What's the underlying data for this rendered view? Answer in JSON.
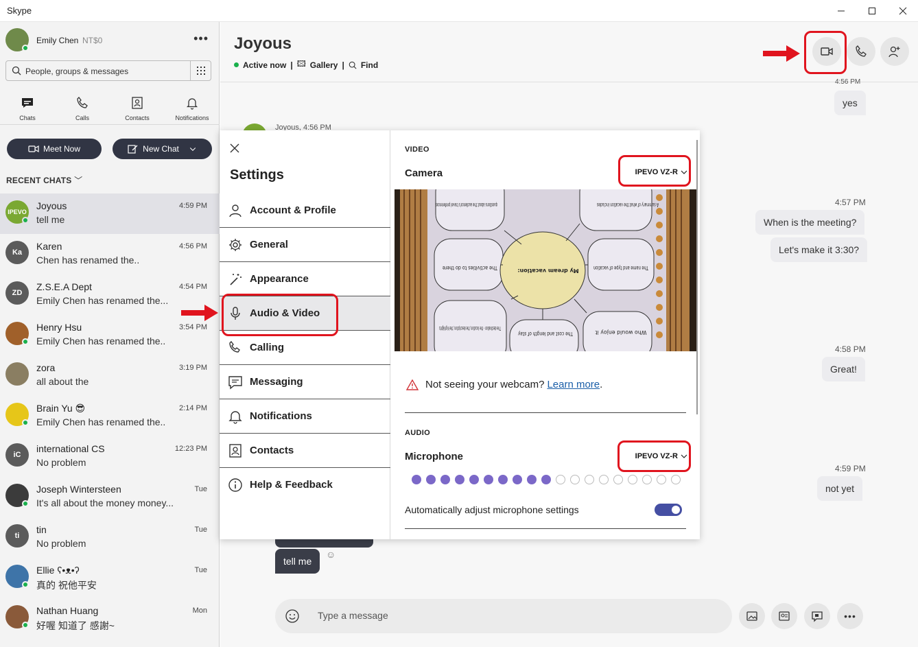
{
  "window": {
    "title": "Skype"
  },
  "profile": {
    "name": "Emily Chen",
    "credit": "NT$0"
  },
  "search": {
    "placeholder": "People, groups & messages"
  },
  "nav": {
    "chats": "Chats",
    "calls": "Calls",
    "contacts": "Contacts",
    "notifications": "Notifications"
  },
  "actions": {
    "meet_now": "Meet Now",
    "new_chat": "New Chat"
  },
  "recent_label": "RECENT CHATS",
  "chats": [
    {
      "name": "Joyous",
      "msg": "tell me",
      "time": "4:59 PM",
      "initials": "IPEVO",
      "color": "#7aa832"
    },
    {
      "name": "Karen",
      "msg": "Chen has renamed the..",
      "time": "4:56 PM",
      "initials": "Ka",
      "color": "#5b5b5b"
    },
    {
      "name": "Z.S.E.A Dept",
      "msg": "Emily Chen has renamed the...",
      "time": "4:54 PM",
      "initials": "ZD",
      "color": "#5b5b5b"
    },
    {
      "name": "Henry Hsu",
      "msg": "Emily Chen has renamed the..",
      "time": "3:54 PM",
      "initials": "",
      "color": "#a0602a"
    },
    {
      "name": "zora",
      "msg": " all about the",
      "time": "3:19 PM",
      "initials": "",
      "color": "#8a7e62"
    },
    {
      "name": "Brain Yu 😎",
      "msg": "Emily Chen has renamed the..",
      "time": "2:14 PM",
      "initials": "",
      "color": "#e6c619"
    },
    {
      "name": "international CS",
      "msg": "No problem",
      "time": "12:23 PM",
      "initials": "iC",
      "color": "#5b5b5b"
    },
    {
      "name": "Joseph Wintersteen",
      "msg": "It's all about the money money...",
      "time": "Tue",
      "initials": "",
      "color": "#3b3b3b"
    },
    {
      "name": "tin",
      "msg": "No problem",
      "time": "Tue",
      "initials": "ti",
      "color": "#5b5b5b"
    },
    {
      "name": "Ellie ʕ•ᴥ•ʔ",
      "msg": "真的 祝他平安",
      "time": "Tue",
      "initials": "",
      "color": "#3e74a8"
    },
    {
      "name": "Nathan Huang",
      "msg": "好喔 知道了 感謝~",
      "time": "Mon",
      "initials": "",
      "color": "#8a5a3a"
    }
  ],
  "conversation": {
    "title": "Joyous",
    "status": "Active now",
    "gallery": "Gallery",
    "find": "Find",
    "partial_time_top": "4:56 PM",
    "partial_sender": "Joyous, 4:56 PM",
    "messages_right": [
      {
        "text": "yes"
      },
      {
        "time": "4:57 PM"
      },
      {
        "text": "When is the meeting?"
      },
      {
        "text": "Let's make it 3:30?"
      },
      {
        "time": "4:58 PM"
      },
      {
        "text": "Great!"
      },
      {
        "time": "4:59 PM"
      },
      {
        "text": "not yet"
      }
    ],
    "last_incoming": "tell me",
    "composer_placeholder": "Type a message"
  },
  "settings": {
    "title": "Settings",
    "items": [
      {
        "label": "Account & Profile"
      },
      {
        "label": "General"
      },
      {
        "label": "Appearance"
      },
      {
        "label": "Audio & Video"
      },
      {
        "label": "Calling"
      },
      {
        "label": "Messaging"
      },
      {
        "label": "Notifications"
      },
      {
        "label": "Contacts"
      },
      {
        "label": "Help & Feedback"
      }
    ],
    "selected_index": 3,
    "video_header": "VIDEO",
    "camera_label": "Camera",
    "camera_device": "IPEVO VZ-R",
    "preview": {
      "center": "My dream vacation:",
      "bubbles": [
        "A summary of what the vacation includes",
        "questions about the audience's travel preferences",
        "The name and type of vacation",
        "The activities to do there",
        "The destination - the location, the description, the highlights",
        "The cost and length of stay",
        "Who would enjoy it"
      ]
    },
    "webcam_warning": "Not seeing your webcam?",
    "learn_more": "Learn more",
    "audio_header": "AUDIO",
    "mic_label": "Microphone",
    "mic_device": "IPEVO VZ-R",
    "mic_level": 0.5,
    "mic_dots_total": 19,
    "mic_dots_active": 10,
    "auto_adjust_label": "Automatically adjust microphone settings",
    "auto_adjust_on": true
  },
  "colors": {
    "accent": "#454fa3",
    "annotation_red": "#e0141e",
    "mic_active": "#7b68c8"
  }
}
